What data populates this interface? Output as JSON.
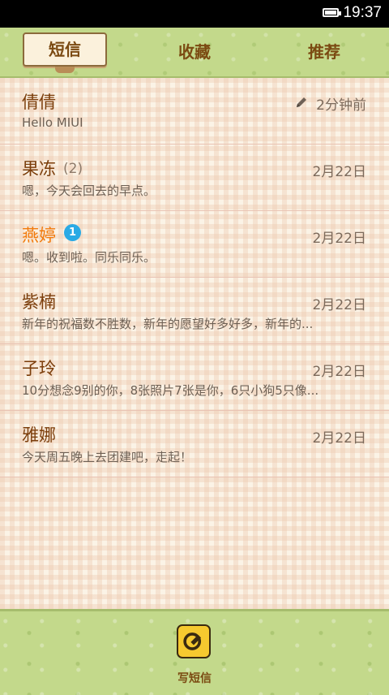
{
  "status_bar": {
    "time": "19:37",
    "battery_icon": "battery-icon"
  },
  "tabs": [
    {
      "label": "短信",
      "selected": true
    },
    {
      "label": "收藏",
      "selected": false
    },
    {
      "label": "推荐",
      "selected": false
    }
  ],
  "conversations": [
    {
      "name": "倩倩",
      "count": "",
      "badge": "",
      "date": "2分钟前",
      "preview": "Hello MIUI",
      "draft": true,
      "unread": false
    },
    {
      "name": "果冻",
      "count": "(2)",
      "badge": "",
      "date": "2月22日",
      "preview": "嗯，今天会回去的早点。",
      "draft": false,
      "unread": false
    },
    {
      "name": "燕婷",
      "count": "",
      "badge": "1",
      "date": "2月22日",
      "preview": "嗯。收到啦。同乐同乐。",
      "draft": false,
      "unread": true
    },
    {
      "name": "紫楠",
      "count": "",
      "badge": "",
      "date": "2月22日",
      "preview": "新年的祝福数不胜数，新年的愿望好多好多，新年的...",
      "draft": false,
      "unread": false
    },
    {
      "name": "子玲",
      "count": "",
      "badge": "",
      "date": "2月22日",
      "preview": "10分想念9别的你，8张照片7张是你，6只小狗5只像...",
      "draft": false,
      "unread": false
    },
    {
      "name": "雅娜",
      "count": "",
      "badge": "",
      "date": "2月22日",
      "preview": "今天周五晚上去团建吧，走起！",
      "draft": false,
      "unread": false
    }
  ],
  "bottom_bar": {
    "compose_label": "写短信",
    "compose_icon": "compose-icon"
  },
  "colors": {
    "accent_unread": "#f27a0b",
    "badge": "#2aaae5",
    "grass": "#c3d98b",
    "name": "#7b3d0a"
  }
}
